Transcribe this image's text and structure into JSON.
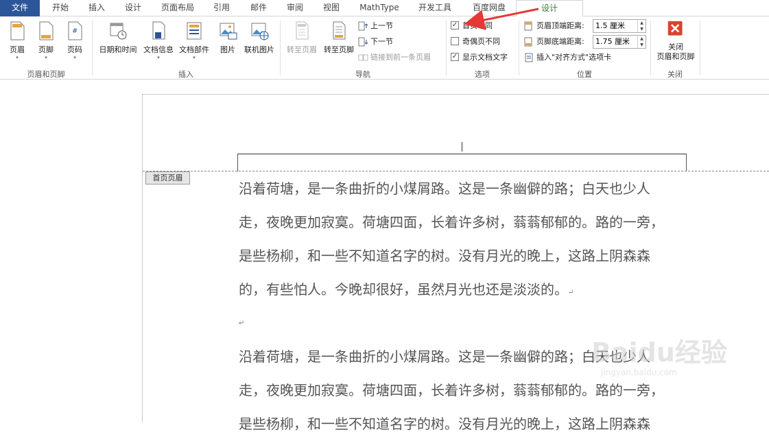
{
  "tabs": [
    "文件",
    "开始",
    "插入",
    "设计",
    "页面布局",
    "引用",
    "邮件",
    "审阅",
    "视图",
    "MathType",
    "开发工具",
    "百度网盘",
    "设计"
  ],
  "ribbon": {
    "groups": {
      "header_footer": {
        "label": "页眉和页脚",
        "buttons": [
          "页眉",
          "页脚",
          "页码"
        ]
      },
      "insert": {
        "label": "插入",
        "buttons": [
          "日期和时间",
          "文档信息",
          "文档部件",
          "图片",
          "联机图片"
        ]
      },
      "navigation": {
        "label": "导航",
        "goto_header": "转至页眉",
        "goto_footer": "转至页脚",
        "prev_section": "上一节",
        "next_section": "下一节",
        "link_prev": "链接到前一条页眉"
      },
      "options": {
        "label": "选项",
        "different_first_page": "首页不同",
        "different_odd_even": "奇偶页不同",
        "show_document_text": "显示文档文字",
        "different_first_page_checked": true,
        "different_odd_even_checked": false,
        "show_document_text_checked": true
      },
      "position": {
        "label": "位置",
        "header_from_top_label": "页眉顶端距离:",
        "header_from_top_value": "1.5 厘米",
        "footer_from_bottom_label": "页脚底端距离:",
        "footer_from_bottom_value": "1.75 厘米",
        "insert_alignment_tab": "插入\"对齐方式\"选项卡"
      },
      "close": {
        "label": "关闭",
        "close_button_line1": "关闭",
        "close_button_line2": "页眉和页脚"
      }
    }
  },
  "document": {
    "header_tag": "首页页眉",
    "paragraph1": [
      "沿着荷塘，是一条曲折的小煤屑路。这是一条幽僻的路；白天也少人",
      "走，夜晚更加寂寞。荷塘四面，长着许多树，蓊蓊郁郁的。路的一旁，",
      "是些杨柳，和一些不知道名字的树。没有月光的晚上，这路上阴森森",
      "的，有些怕人。今晚却很好，虽然月光也还是淡淡的。"
    ],
    "paragraph2": [
      "沿着荷塘，是一条曲折的小煤屑路。这是一条幽僻的路；白天也少人",
      "走，夜晚更加寂寞。荷塘四面，长着许多树，蓊蓊郁郁的。路的一旁，",
      "是些杨柳，和一些不知道名字的树。没有月光的晚上，这路上阴森森"
    ],
    "para_mark": "↵"
  },
  "watermark": {
    "text": "Baidu经验",
    "subtext": "jingyan.baidu.com"
  },
  "colors": {
    "file_tab": "#2b579a",
    "active_tab_text": "#2e7d32",
    "arrow": "#e53935",
    "close_icon": "#d9432f"
  }
}
